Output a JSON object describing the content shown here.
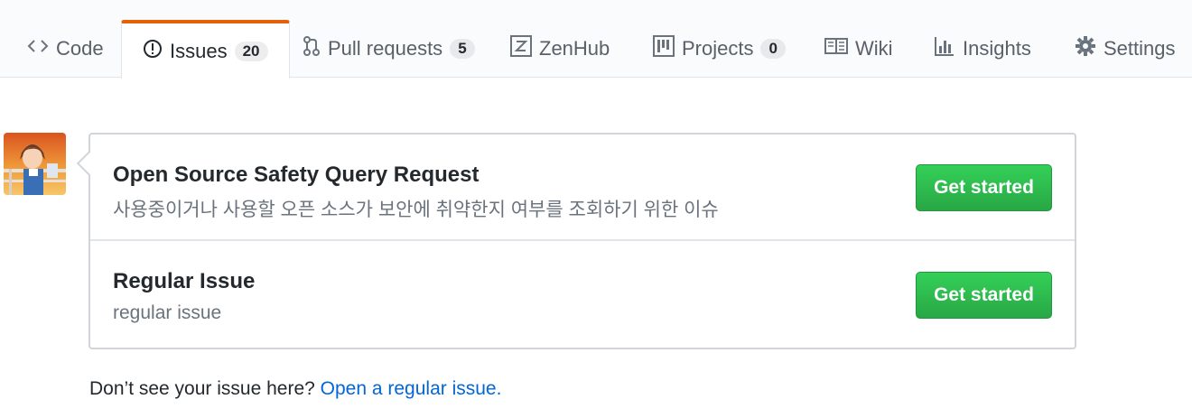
{
  "tabs": {
    "code": {
      "label": "Code"
    },
    "issues": {
      "label": "Issues",
      "count": "20"
    },
    "pulls": {
      "label": "Pull requests",
      "count": "5"
    },
    "zenhub": {
      "label": "ZenHub"
    },
    "projects": {
      "label": "Projects",
      "count": "0"
    },
    "wiki": {
      "label": "Wiki"
    },
    "insights": {
      "label": "Insights"
    },
    "settings": {
      "label": "Settings"
    }
  },
  "templates": [
    {
      "title": "Open Source Safety Query Request",
      "description": "사용중이거나 사용할 오픈 소스가 보안에 취약한지 여부를 조회하기 위한 이슈",
      "button": "Get started"
    },
    {
      "title": "Regular Issue",
      "description": "regular issue",
      "button": "Get started"
    }
  ],
  "footer": {
    "text": "Don’t see your issue here?",
    "link": "Open a regular issue."
  },
  "colors": {
    "selected_tab_accent": "#e36209",
    "button_green": "#28a745",
    "link_blue": "#0366d6"
  }
}
